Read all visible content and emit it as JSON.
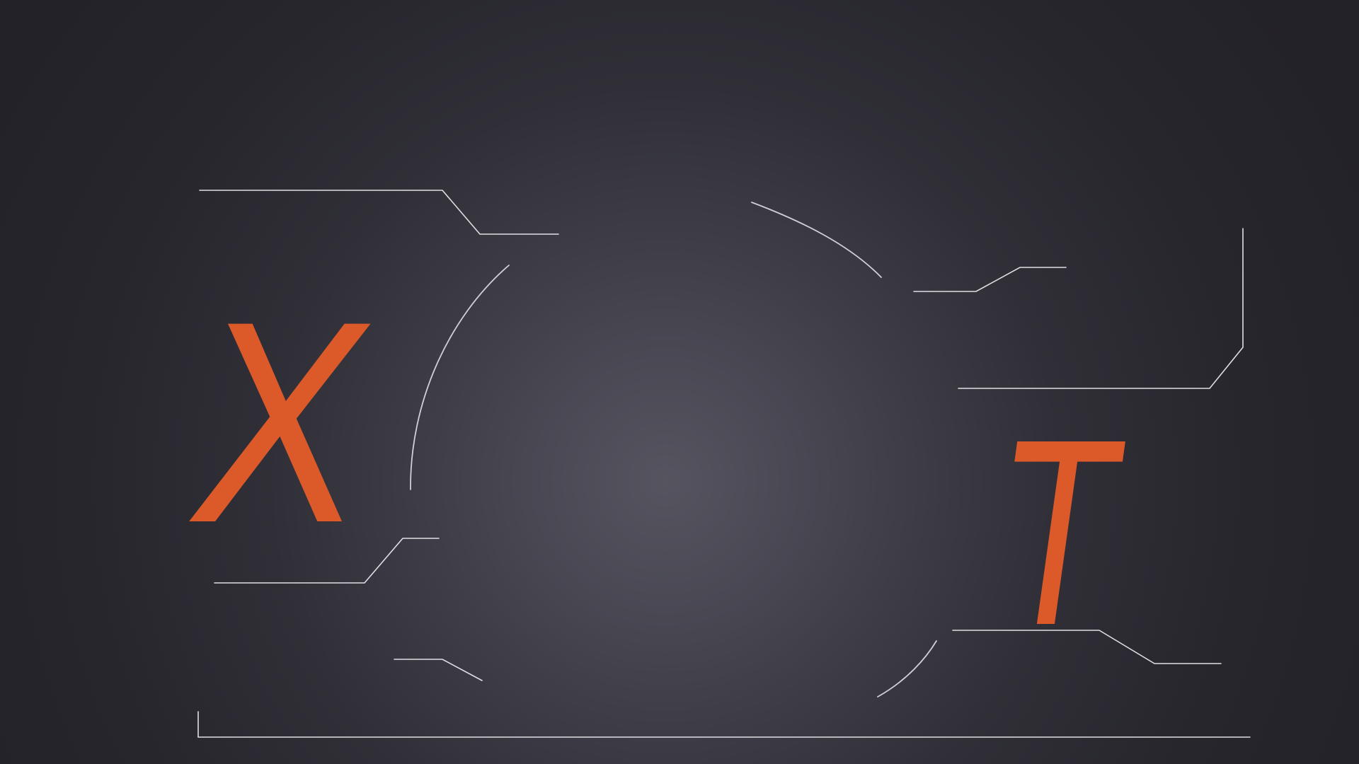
{
  "letters": {
    "left": "X",
    "right": "T"
  },
  "colors": {
    "background_dark": "#27262d",
    "background_center": "#55545f",
    "accent": "#dc5a2a",
    "line": "#e9e9ee"
  },
  "decorations": {
    "line_style": "thin white HUD connector lines",
    "arc_style": "partial circular arcs"
  }
}
